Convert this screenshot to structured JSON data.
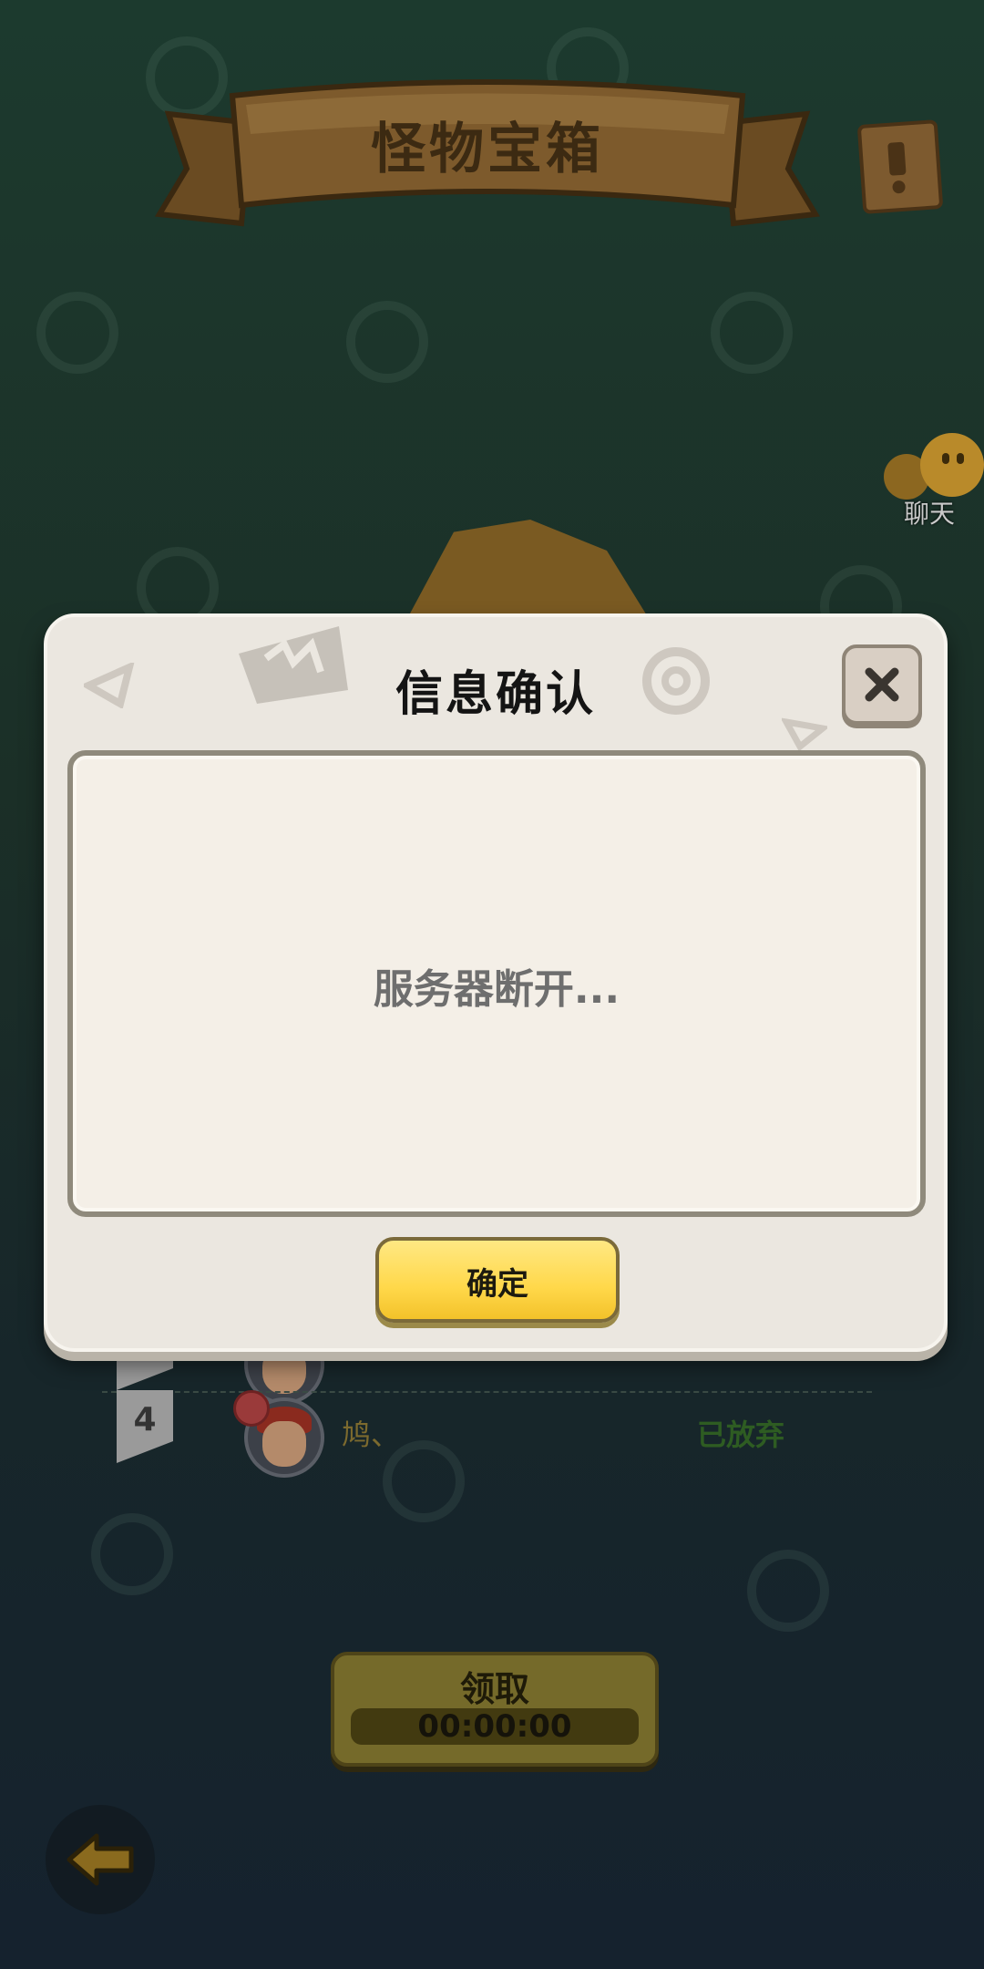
{
  "screen": {
    "title": "怪物宝箱",
    "chat_label": "聊天"
  },
  "players": [
    {
      "rank": "",
      "name": "",
      "status": ""
    },
    {
      "rank": "4",
      "name": "鸠、",
      "status": "已放弃"
    }
  ],
  "claim": {
    "label": "领取",
    "timer": "00:00:00"
  },
  "dialog": {
    "title": "信息确认",
    "message": "服务器断开...",
    "ok_label": "确定"
  },
  "colors": {
    "dialog_bg": "#ebe7e0",
    "ok_button": "#ffd84a",
    "status_green": "#2e5c22"
  },
  "icons": [
    "close-icon",
    "back-arrow-icon",
    "chat-bubble-icon",
    "scroll-icon"
  ]
}
